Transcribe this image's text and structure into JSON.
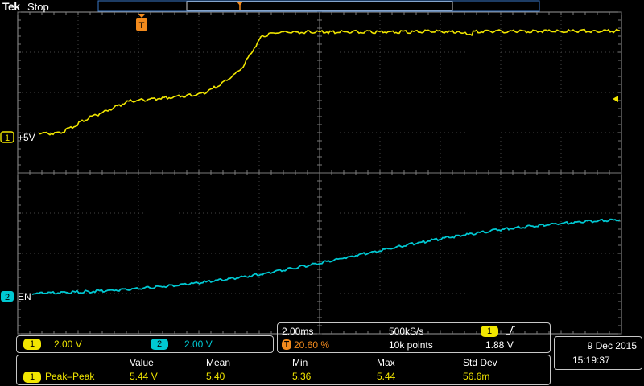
{
  "header": {
    "brand": "Tek",
    "acquisition_state": "Stop"
  },
  "trigger_marker": {
    "label": "T"
  },
  "channels": [
    {
      "number": "1",
      "label": "+5V",
      "color": "#f1e600"
    },
    {
      "number": "2",
      "label": "EN",
      "color": "#00c8d2"
    }
  ],
  "vertical": {
    "ch1_scale": "2.00 V",
    "ch2_scale": "2.00 V"
  },
  "horizontal": {
    "time_scale": "2.00ms",
    "sample_rate": "500kS/s",
    "trigger_position": "20.60 %",
    "record_length": "10k points",
    "trigger_source": "1",
    "trigger_slope_icon": "rising-edge-icon",
    "trigger_level": "1.88 V"
  },
  "timestamp": {
    "date": "9 Dec  2015",
    "time": "15:19:37"
  },
  "measurements": {
    "headers": [
      "Value",
      "Mean",
      "Min",
      "Max",
      "Std Dev"
    ],
    "rows": [
      {
        "channel": "1",
        "name": "Peak–Peak",
        "values": [
          "5.44 V",
          "5.40",
          "5.36",
          "5.44",
          "56.6m"
        ]
      }
    ]
  },
  "colors": {
    "ch1": "#f1e600",
    "ch2": "#00c8d2",
    "trigger": "#f28a1d",
    "graticule": "#7a7a7a"
  }
}
